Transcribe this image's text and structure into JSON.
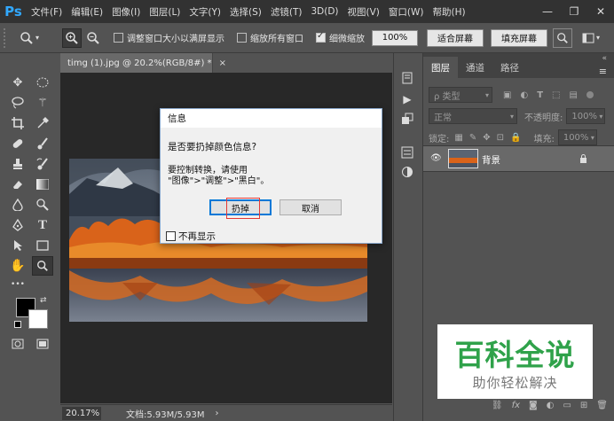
{
  "app": {
    "logo": "Ps"
  },
  "menu": [
    "文件(F)",
    "编辑(E)",
    "图像(I)",
    "图层(L)",
    "文字(Y)",
    "选择(S)",
    "滤镜(T)",
    "3D(D)",
    "视图(V)",
    "窗口(W)",
    "帮助(H)"
  ],
  "window_controls": {
    "minimize": "—",
    "restore": "❐",
    "close": "✕"
  },
  "options_bar": {
    "tool_icon": "zoom-tool-icon",
    "zoom_in": "+",
    "zoom_out": "−",
    "resize_windows": "调整窗口大小以满屏显示",
    "zoom_all_windows": "缩放所有窗口",
    "scrubby_zoom": "细微缩放",
    "zoom_percent": "100%",
    "fit_screen": "适合屏幕",
    "fill_screen": "填充屏幕",
    "resize_checked": false,
    "zoom_all_checked": false,
    "scrubby_checked": true
  },
  "document": {
    "tab_title": "timg (1).jpg @ 20.2%(RGB/8#) *",
    "tab_close": "×",
    "zoom_status": "20.17%",
    "doc_status": "文档:5.93M/5.93M",
    "status_arrow": "›"
  },
  "tools": {
    "foreground": "#000000",
    "background": "#ffffff",
    "more": "•••"
  },
  "layers_panel": {
    "tabs": [
      "图层",
      "通道",
      "路径"
    ],
    "kind_filter": "ρ 类型",
    "blend_mode": "正常",
    "opacity_label": "不透明度:",
    "opacity_value": "100%",
    "lock_label": "锁定:",
    "fill_label": "填充:",
    "fill_value": "100%",
    "layer_name": "背景",
    "panel_menu": "≡",
    "collapse": "«"
  },
  "dialog": {
    "title": "信息",
    "question": "是否要扔掉颜色信息?",
    "hint_line1": "要控制转换，请使用",
    "hint_line2": "\"图像\">\"调整\">\"黑白\"。",
    "discard": "扔掉",
    "cancel": "取消",
    "dont_show": "不再显示"
  },
  "watermark": {
    "title": "百科全说",
    "subtitle": "助你轻松解决"
  },
  "colors": {
    "accent": "#31a8ff",
    "watermark_green": "#2fa24a",
    "highlight_red": "#e53935"
  }
}
